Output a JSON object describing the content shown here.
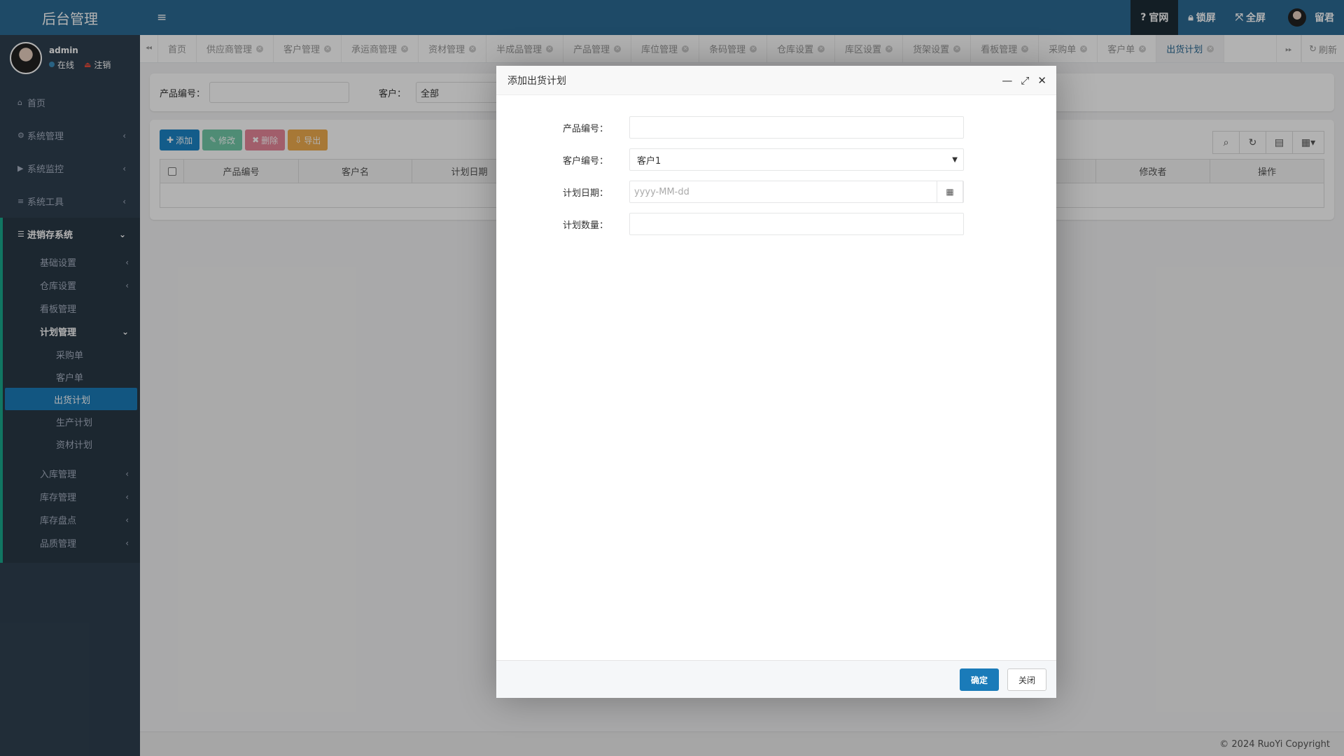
{
  "sidebar": {
    "logo": "后台管理",
    "user": {
      "name": "admin",
      "status": "在线",
      "logout": "注销"
    },
    "menu": {
      "home": "首页",
      "system": "系统管理",
      "monitor": "系统监控",
      "tools": "系统工具",
      "erp": "进销存系统"
    },
    "erp_items": {
      "basic": "基础设置",
      "warehouse": "仓库设置",
      "board": "看板管理",
      "plan": "计划管理",
      "inbound": "入库管理",
      "stock": "库存管理",
      "inventory": "库存盘点",
      "quality": "品质管理"
    },
    "plan_items": [
      "采购单",
      "客户单",
      "出货计划",
      "生产计划",
      "资材计划"
    ]
  },
  "topbar": {
    "official": "官网",
    "lock": "锁屏",
    "fullscreen": "全屏",
    "username": "留君"
  },
  "tabs": [
    "首页",
    "供应商管理",
    "客户管理",
    "承运商管理",
    "资材管理",
    "半成品管理",
    "产品管理",
    "库位管理",
    "条码管理",
    "仓库设置",
    "库区设置",
    "货架设置",
    "看板管理",
    "采购单",
    "客户单",
    "出货计划"
  ],
  "refresh_label": "刷新",
  "search": {
    "product_label": "产品编号：",
    "customer_label": "客户：",
    "customer_value": "全部"
  },
  "toolbar": {
    "add": "添加",
    "edit": "修改",
    "delete": "删除",
    "export": "导出"
  },
  "table": {
    "headers_left": [
      "产品编号",
      "客户名",
      "计划日期"
    ],
    "headers_right": [
      "修改者",
      "操作"
    ]
  },
  "footer": "© 2024 RuoYi Copyright",
  "modal": {
    "title": "添加出货计划",
    "fields": {
      "product_label": "产品编号：",
      "customer_label": "客户编号：",
      "customer_value": "客户1",
      "date_label": "计划日期：",
      "date_placeholder": "yyyy-MM-dd",
      "qty_label": "计划数量："
    },
    "ok": "确定",
    "close": "关闭"
  }
}
